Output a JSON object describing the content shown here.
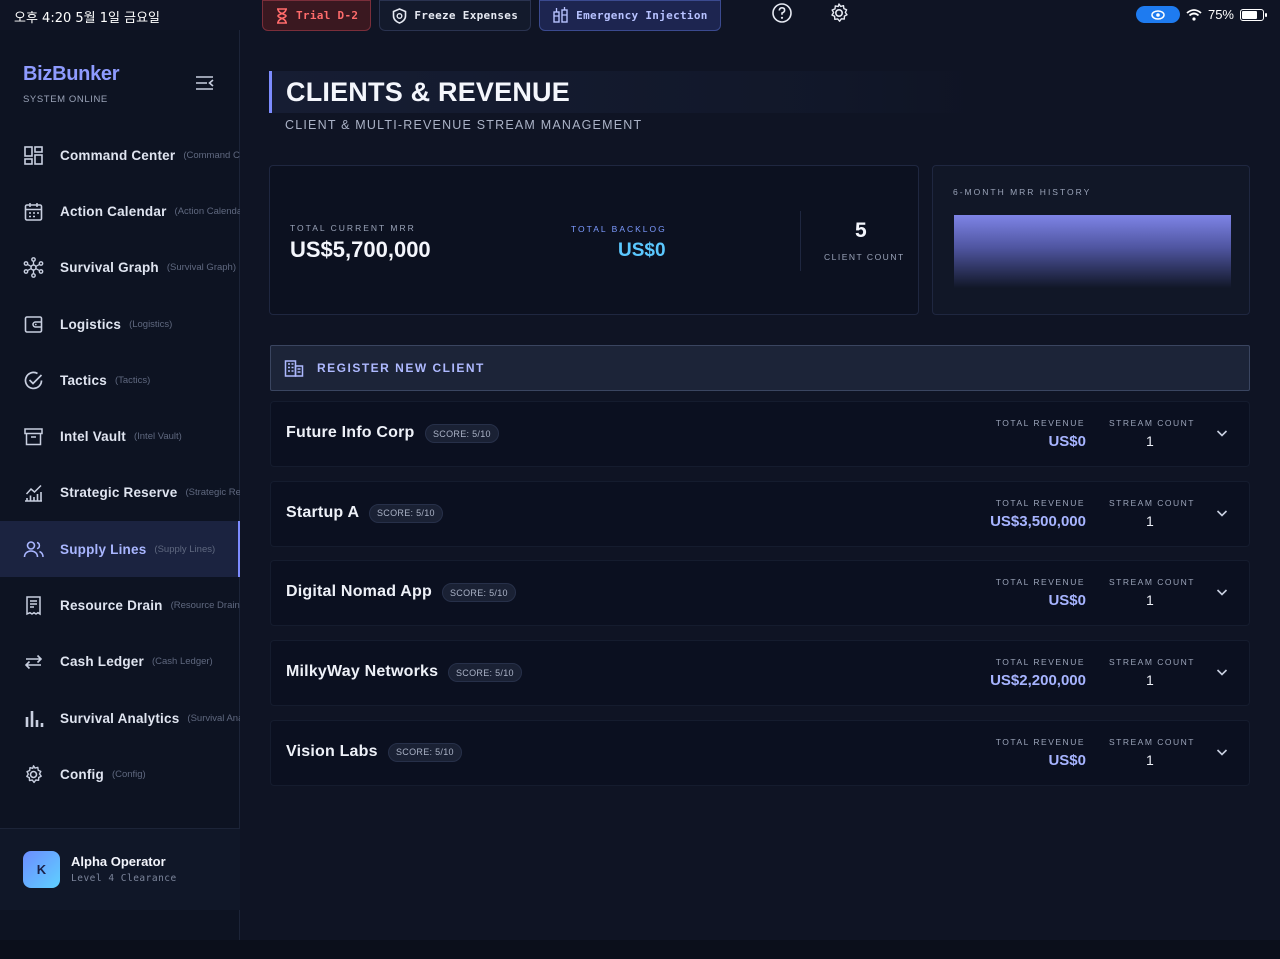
{
  "status_bar": {
    "time": "오후 4:20  5월 1일 금요일",
    "battery": "75%"
  },
  "top_actions": {
    "trial": "Trial D-2",
    "freeze": "Freeze Expenses",
    "emergency": "Emergency Injection"
  },
  "sidebar": {
    "brand": "BizBunker",
    "status": "SYSTEM ONLINE",
    "items": [
      {
        "label": "Command Center",
        "sub": "(Command Center)",
        "icon": "grid-icon"
      },
      {
        "label": "Action Calendar",
        "sub": "(Action Calendar)",
        "icon": "calendar-icon"
      },
      {
        "label": "Survival Graph",
        "sub": "(Survival Graph)",
        "icon": "network-icon"
      },
      {
        "label": "Logistics",
        "sub": "(Logistics)",
        "icon": "wallet-icon"
      },
      {
        "label": "Tactics",
        "sub": "(Tactics)",
        "icon": "check-circle-icon"
      },
      {
        "label": "Intel Vault",
        "sub": "(Intel Vault)",
        "icon": "archive-icon"
      },
      {
        "label": "Strategic Reserve",
        "sub": "(Strategic Reserve)",
        "icon": "chart-icon"
      },
      {
        "label": "Supply Lines",
        "sub": "(Supply Lines)",
        "icon": "users-icon"
      },
      {
        "label": "Resource Drain",
        "sub": "(Resource Drain)",
        "icon": "receipt-icon"
      },
      {
        "label": "Cash Ledger",
        "sub": "(Cash Ledger)",
        "icon": "transfer-icon"
      },
      {
        "label": "Survival Analytics",
        "sub": "(Survival Analytics)",
        "icon": "bar-chart-icon"
      },
      {
        "label": "Config",
        "sub": "(Config)",
        "icon": "gear-icon"
      }
    ],
    "active_index": 7,
    "profile": {
      "initial": "K",
      "name": "Alpha Operator",
      "level": "Level 4 Clearance"
    }
  },
  "main": {
    "title": "CLIENTS & REVENUE",
    "subtitle": "CLIENT & MULTI-REVENUE STREAM MANAGEMENT",
    "stats": {
      "mrr_label": "TOTAL CURRENT MRR",
      "mrr_value": "US$5,700,000",
      "backlog_label": "TOTAL BACKLOG",
      "backlog_value": "US$0",
      "client_count": "5",
      "client_count_label": "CLIENT COUNT"
    },
    "mrr_history_title": "6-MONTH MRR HISTORY",
    "register_label": "REGISTER NEW CLIENT",
    "revenue_label": "TOTAL REVENUE",
    "stream_label": "STREAM COUNT",
    "clients": [
      {
        "name": "Future Info Corp",
        "score": "SCORE: 5/10",
        "revenue": "US$0",
        "streams": "1"
      },
      {
        "name": "Startup A",
        "score": "SCORE: 5/10",
        "revenue": "US$3,500,000",
        "streams": "1"
      },
      {
        "name": "Digital Nomad App",
        "score": "SCORE: 5/10",
        "revenue": "US$0",
        "streams": "1"
      },
      {
        "name": "MilkyWay Networks",
        "score": "SCORE: 5/10",
        "revenue": "US$2,200,000",
        "streams": "1"
      },
      {
        "name": "Vision Labs",
        "score": "SCORE: 5/10",
        "revenue": "US$0",
        "streams": "1"
      }
    ]
  },
  "colors": {
    "accent": "#7d8cff",
    "danger": "#ff6b6b",
    "background": "#0f1424"
  }
}
